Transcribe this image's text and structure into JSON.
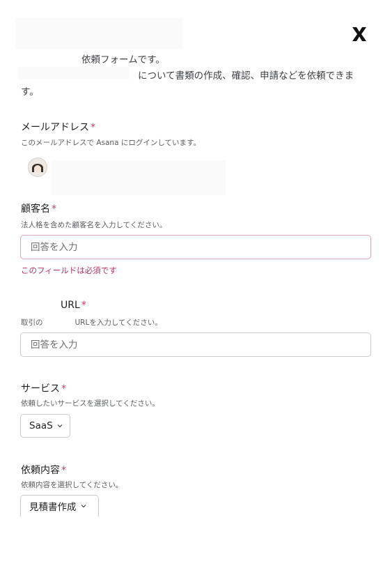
{
  "header": {
    "intro_line1": "依頼フォームです。",
    "intro_line2": "について書類の作成、確認、申請などを依頼できま",
    "intro_line3": "す。"
  },
  "email": {
    "label": "メールアドレス",
    "required_mark": "*",
    "description": "このメールアドレスで Asana にログインしています。"
  },
  "customer": {
    "label": "顧客名",
    "required_mark": "*",
    "description": "法人格を含めた顧客名を入力してください。",
    "placeholder": "回答を入力",
    "value": "",
    "error": "このフィールドは必須です"
  },
  "url_field": {
    "label": "URL",
    "required_mark": "*",
    "description_prefix": "取引の",
    "description_suffix": "URLを入力してください。",
    "placeholder": "回答を入力",
    "value": ""
  },
  "service": {
    "label": "サービス",
    "required_mark": "*",
    "description": "依頼したいサービスを選択してください。",
    "selected": "SaaS"
  },
  "request": {
    "label": "依頼内容",
    "required_mark": "*",
    "description": "依頼内容を選択してください。",
    "selected": "見積書作成"
  },
  "colors": {
    "required": "#d1395a",
    "error": "#b1355c",
    "border": "#cfcbcb"
  },
  "icons": {
    "close": "close-x-icon",
    "avatar": "user-avatar",
    "dropdown": "chevron-down-icon"
  }
}
